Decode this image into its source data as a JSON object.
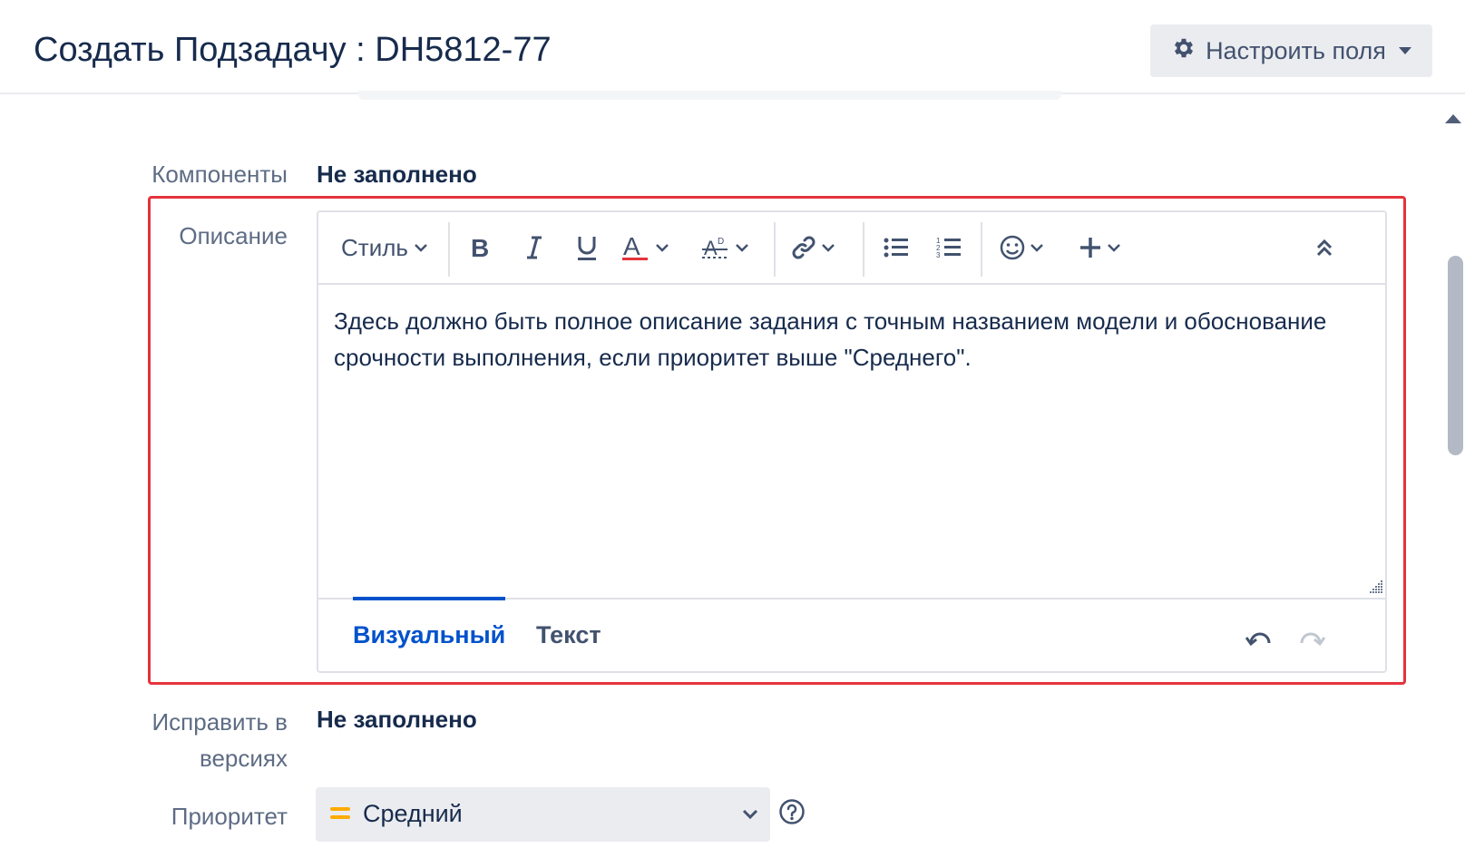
{
  "header": {
    "title": "Создать Подзадачу : DH5812-77",
    "configure_fields_label": "Настроить поля"
  },
  "fields": {
    "components": {
      "label": "Компоненты",
      "value": "Не заполнено"
    },
    "description": {
      "label": "Описание",
      "toolbar": {
        "style_label": "Стиль",
        "items": [
          "bold-icon",
          "italic-icon",
          "underline-icon",
          "text-color-icon",
          "text-effects-icon",
          "link-icon",
          "bullet-list-icon",
          "numbered-list-icon",
          "emoji-icon",
          "insert-more-icon",
          "collapse-toolbar-icon"
        ]
      },
      "text": "Здесь должно быть полное описание задания с точным названием модели и обоснование срочности выполнения, если приоритет выше \"Среднего\".",
      "tabs": {
        "visual": "Визуальный",
        "text": "Текст",
        "active": "visual"
      }
    },
    "fix_versions": {
      "label_line1": "Исправить в",
      "label_line2": "версиях",
      "value": "Не заполнено"
    },
    "priority": {
      "label": "Приоритет",
      "value": "Средний"
    }
  },
  "colors": {
    "accent": "#0052cc",
    "highlight_border": "#e5333c",
    "priority_medium": "#ffab00",
    "text_color_underline": "#e5333c"
  }
}
